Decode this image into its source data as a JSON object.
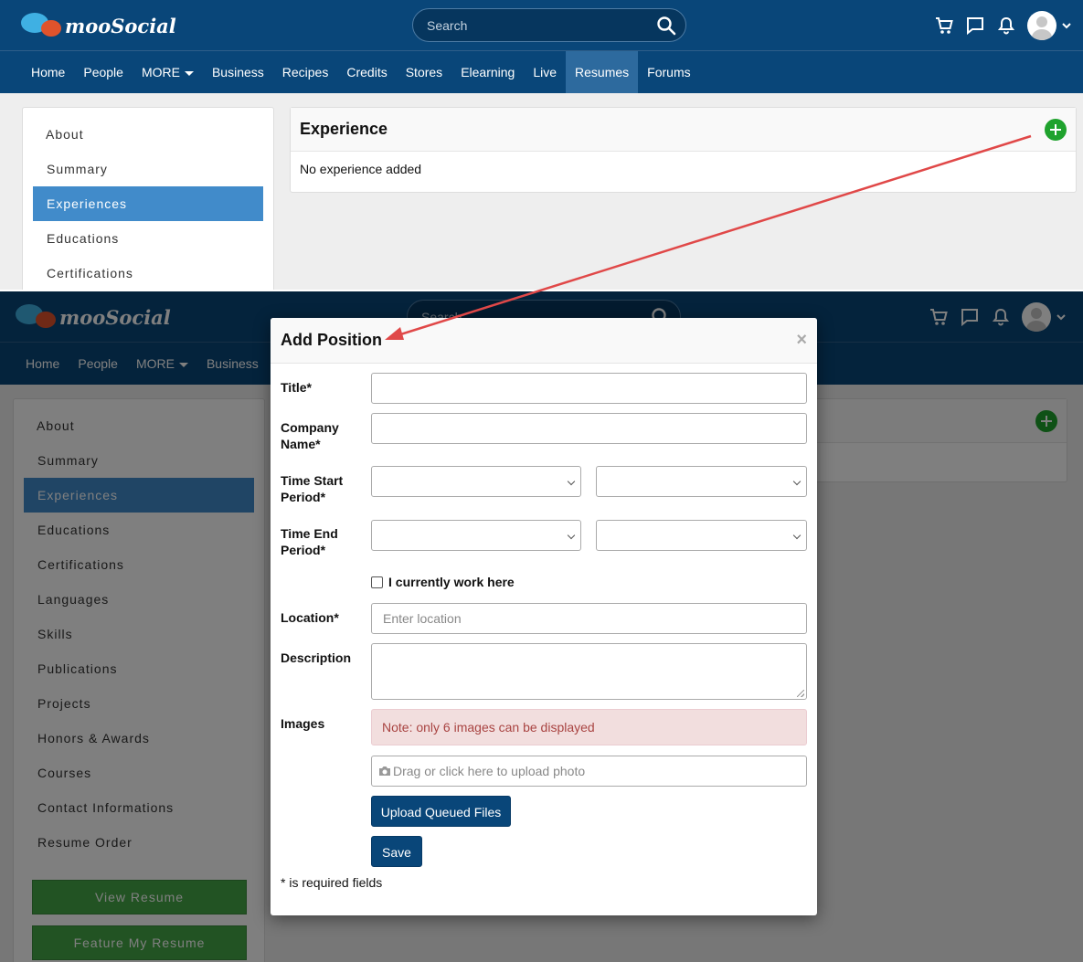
{
  "brand": {
    "name": "mooSocial"
  },
  "search": {
    "placeholder": "Search"
  },
  "nav": {
    "items": [
      "Home",
      "People",
      "MORE",
      "Business",
      "Recipes",
      "Credits",
      "Stores",
      "Elearning",
      "Live",
      "Resumes",
      "Forums"
    ],
    "active": "Resumes"
  },
  "sidebar": {
    "items": [
      "About",
      "Summary",
      "Experiences",
      "Educations",
      "Certifications",
      "Languages",
      "Skills",
      "Publications",
      "Projects",
      "Honors & Awards",
      "Courses",
      "Contact Informations",
      "Resume Order"
    ],
    "active": "Experiences",
    "buttons": {
      "view": "View Resume",
      "feature": "Feature My Resume"
    }
  },
  "experience": {
    "title": "Experience",
    "empty": "No experience added"
  },
  "modal": {
    "title": "Add Position",
    "close": "×",
    "fields": {
      "title": "Title*",
      "company": "Company Name*",
      "start": "Time Start Period*",
      "end": "Time End Period*",
      "current": "I currently work here",
      "location": "Location*",
      "location_placeholder": "Enter location",
      "description": "Description",
      "images": "Images"
    },
    "note": "Note: only 6 images can be displayed",
    "upload_hint": "Drag or click here to upload photo",
    "upload_button": "Upload Queued Files",
    "save_button": "Save",
    "required_note": "* is required fields"
  },
  "colors": {
    "header": "#094679",
    "active_side": "#418bca",
    "green": "#1fa22d",
    "arrow": "#e04848"
  }
}
